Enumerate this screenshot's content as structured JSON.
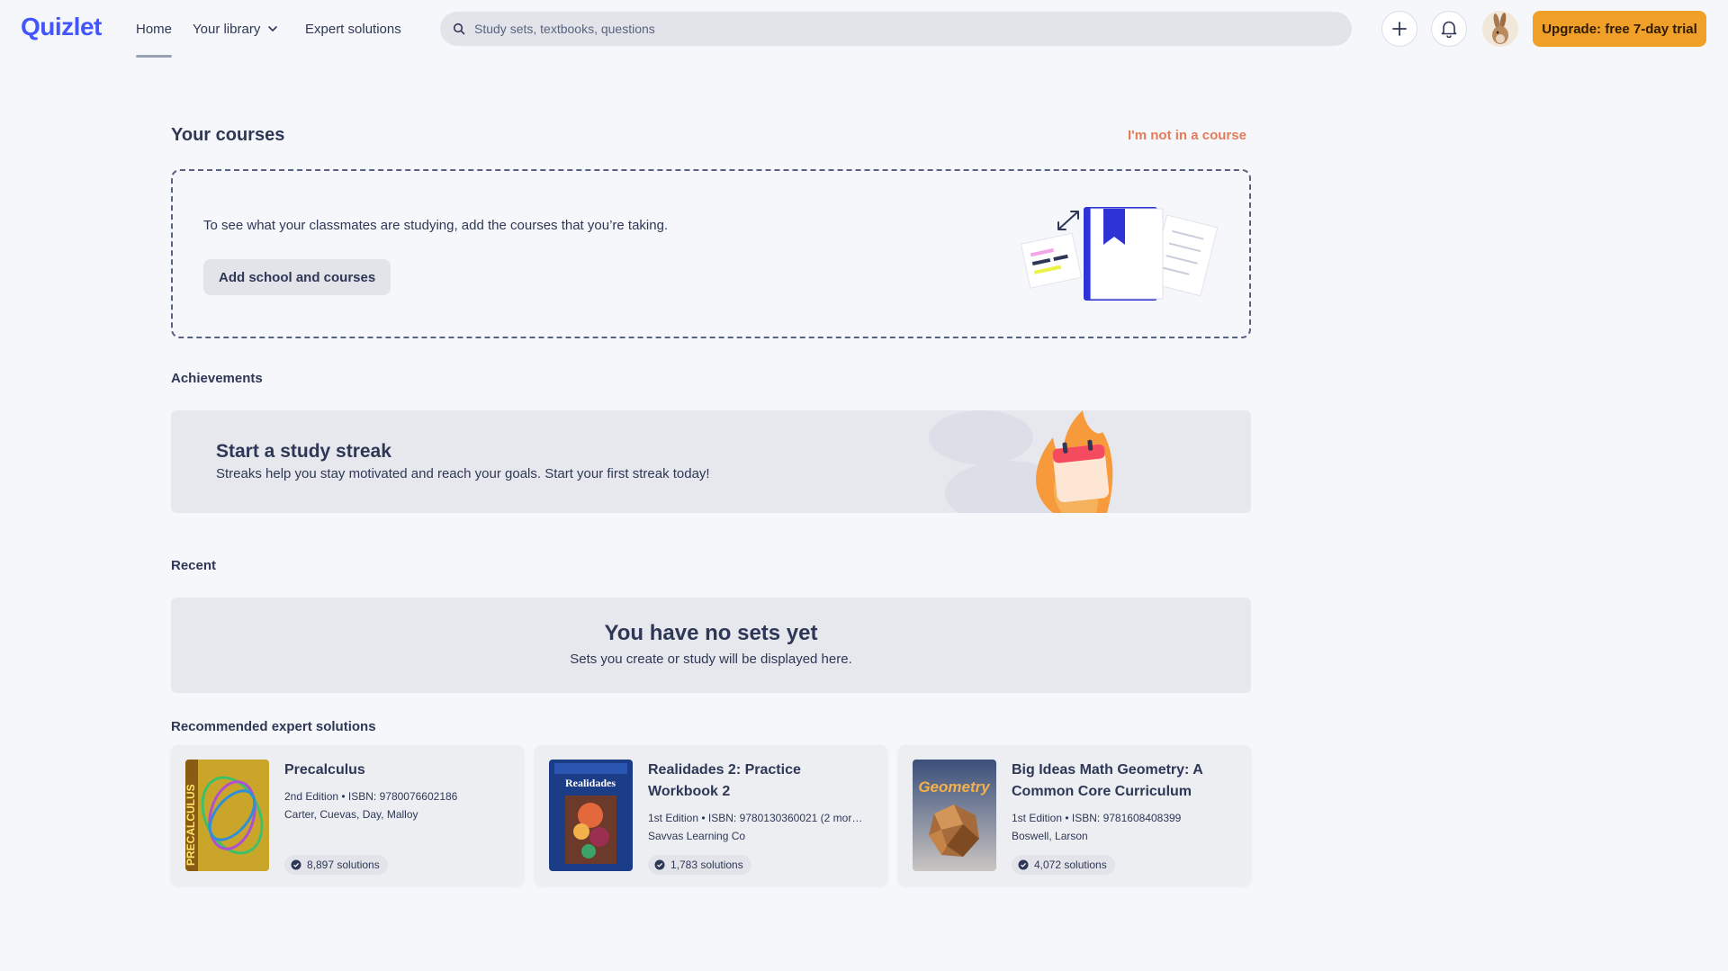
{
  "header": {
    "logo": "Quizlet",
    "nav": {
      "home": "Home",
      "library": "Your library",
      "expert": "Expert solutions"
    },
    "search_placeholder": "Study sets, textbooks, questions",
    "upgrade_label": "Upgrade: free 7-day trial",
    "icons": [
      "plus-icon",
      "bell-icon",
      "avatar"
    ]
  },
  "courses": {
    "title": "Your courses",
    "not_in_course": "I'm not in a course",
    "prompt": "To see what your classmates are studying, add the courses that you’re taking.",
    "button": "Add school and courses"
  },
  "achievements": {
    "title": "Achievements",
    "heading": "Start a study streak",
    "sub": "Streaks help you stay motivated and reach your goals. Start your first streak today!"
  },
  "recent": {
    "title": "Recent",
    "empty_title": "You have no sets yet",
    "empty_sub": "Sets you create or study will be displayed here."
  },
  "recommended": {
    "title": "Recommended expert solutions",
    "cards": [
      {
        "title": "Precalculus",
        "edition": "2nd Edition • ISBN: 9780076602186",
        "authors": "Carter, Cuevas, Day, Malloy",
        "solutions": "8,897 solutions",
        "cover_text": "PRECALCULUS"
      },
      {
        "title": "Realidades 2: Practice Workbook 2",
        "edition": "1st Edition • ISBN: 9780130360021 (2 mor…",
        "authors": "Savvas Learning Co",
        "solutions": "1,783 solutions",
        "cover_text": "Realidades"
      },
      {
        "title": "Big Ideas Math Geometry: A Common Core Curriculum",
        "edition": "1st Edition • ISBN: 9781608408399",
        "authors": "Boswell, Larson",
        "solutions": "4,072 solutions",
        "cover_text": "Geometry"
      }
    ]
  },
  "colors": {
    "brand": "#4255ff",
    "upgrade": "#f0a029",
    "link_accent": "#e57b5a"
  }
}
